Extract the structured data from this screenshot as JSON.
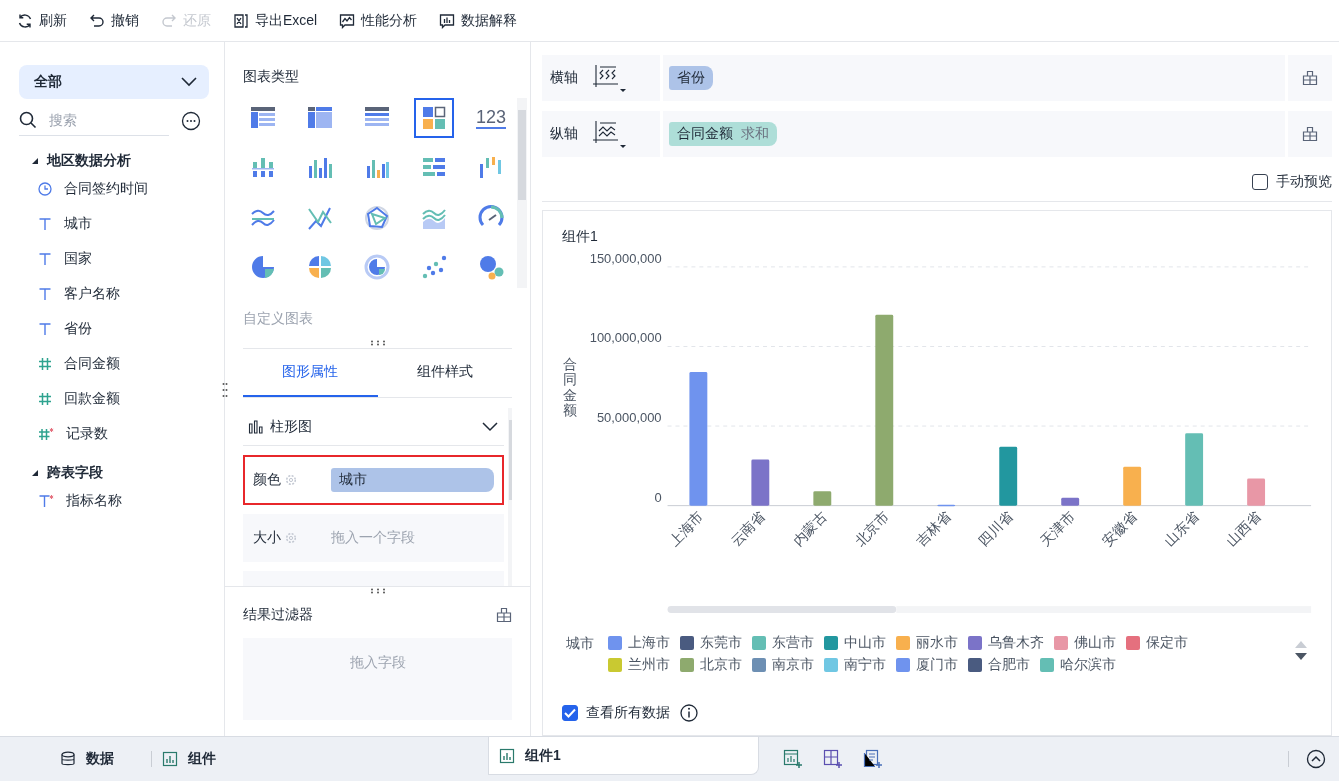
{
  "toolbar": [
    {
      "label": "刷新",
      "disabled": false
    },
    {
      "label": "撤销",
      "disabled": false
    },
    {
      "label": "还原",
      "disabled": true
    },
    {
      "label": "导出Excel",
      "disabled": false
    },
    {
      "label": "性能分析",
      "disabled": false
    },
    {
      "label": "数据解释",
      "disabled": false
    }
  ],
  "fields_panel": {
    "scope": "全部",
    "search": {
      "placeholder": "搜索"
    },
    "groups": [
      {
        "label": "地区数据分析",
        "expanded": true,
        "children": [
          {
            "label": "合同签约时间",
            "kind": "time"
          },
          {
            "label": "城市",
            "kind": "text"
          },
          {
            "label": "国家",
            "kind": "text"
          },
          {
            "label": "客户名称",
            "kind": "text"
          },
          {
            "label": "省份",
            "kind": "text"
          },
          {
            "label": "合同金额",
            "kind": "number"
          },
          {
            "label": "回款金额",
            "kind": "number"
          },
          {
            "label": "记录数",
            "kind": "calc-number"
          }
        ]
      },
      {
        "label": "跨表字段",
        "expanded": true,
        "children": [
          {
            "label": "指标名称",
            "kind": "calc-text"
          }
        ]
      }
    ]
  },
  "chart_types": {
    "title": "图表类型",
    "items": [
      {
        "kind": "table",
        "selected": false
      },
      {
        "kind": "group-table",
        "selected": false
      },
      {
        "kind": "cross-table",
        "selected": false
      },
      {
        "kind": "auto",
        "selected": true
      },
      {
        "kind": "number",
        "label": "123",
        "selected": false
      },
      {
        "kind": "grouped-bar",
        "selected": false
      },
      {
        "kind": "bar",
        "selected": false
      },
      {
        "kind": "multi-bar",
        "selected": false
      },
      {
        "kind": "hbar",
        "selected": false
      },
      {
        "kind": "range-bar",
        "selected": false
      },
      {
        "kind": "line",
        "selected": false
      },
      {
        "kind": "cross-line",
        "selected": false
      },
      {
        "kind": "radar",
        "selected": false
      },
      {
        "kind": "area",
        "selected": false
      },
      {
        "kind": "gauge",
        "selected": false
      },
      {
        "kind": "pie",
        "selected": false
      },
      {
        "kind": "multi-pie",
        "selected": false
      },
      {
        "kind": "ring",
        "selected": false
      },
      {
        "kind": "scatter",
        "selected": false
      },
      {
        "kind": "bubble",
        "selected": false
      }
    ],
    "custom_label": "自定义图表"
  },
  "prop_tabs": [
    {
      "label": "图形属性",
      "selected": true
    },
    {
      "label": "组件样式",
      "selected": false
    }
  ],
  "chart_kind": "柱形图",
  "props": [
    {
      "label": "颜色",
      "value": "城市",
      "highlighted": true
    },
    {
      "label": "大小",
      "placeholder": "拖入一个字段",
      "highlighted": false
    }
  ],
  "result_filter": {
    "title": "结果过滤器",
    "placeholder": "拖入字段"
  },
  "axes": [
    {
      "label": "横轴",
      "field": "省份",
      "kind": "dimension"
    },
    {
      "label": "纵轴",
      "field": "合同金额",
      "aggregation": "求和",
      "kind": "measure"
    }
  ],
  "manual_preview": {
    "label": "手动预览",
    "checked": false
  },
  "widget": {
    "title": "组件1",
    "chart_data": {
      "type": "bar",
      "ylabel": "合同金额",
      "categories": [
        "上海市",
        "云南省",
        "内蒙古",
        "北京市",
        "吉林省",
        "四川省",
        "天津市",
        "安徽省",
        "山东省",
        "山西省"
      ],
      "series": [
        {
          "color": "#6f93ee",
          "values": [
            84000000,
            null,
            null,
            null,
            600000,
            null,
            null,
            null,
            null,
            null
          ]
        },
        {
          "color": "#7b73c8",
          "values": [
            null,
            29000000,
            null,
            null,
            null,
            null,
            5000000,
            null,
            null,
            null
          ]
        },
        {
          "color": "#8eaa6e",
          "values": [
            null,
            null,
            9000000,
            120000000,
            null,
            null,
            null,
            null,
            null,
            null
          ]
        },
        {
          "color": "#22979f",
          "values": [
            null,
            null,
            null,
            null,
            null,
            37000000,
            null,
            null,
            null,
            null
          ]
        },
        {
          "color": "#f8b04e",
          "values": [
            null,
            null,
            null,
            null,
            null,
            null,
            null,
            24500000,
            null,
            null
          ]
        },
        {
          "color": "#64beb4",
          "values": [
            null,
            null,
            null,
            null,
            null,
            null,
            null,
            null,
            45500000,
            null
          ]
        },
        {
          "color": "#e897a6",
          "values": [
            null,
            null,
            null,
            null,
            null,
            null,
            null,
            null,
            null,
            17000000
          ]
        }
      ],
      "ylim": [
        0,
        150000000
      ],
      "yticks": [
        {
          "value": 0,
          "label": "0"
        },
        {
          "value": 50000000,
          "label": "50,000,000"
        },
        {
          "value": 100000000,
          "label": "100,000,000"
        },
        {
          "value": 150000000,
          "label": "150,000,000"
        }
      ]
    },
    "legend": {
      "title": "城市",
      "items": [
        {
          "label": "上海市",
          "color": "#6f93ee"
        },
        {
          "label": "东莞市",
          "color": "#4a5b80"
        },
        {
          "label": "东营市",
          "color": "#64beb4"
        },
        {
          "label": "中山市",
          "color": "#22979f"
        },
        {
          "label": "丽水市",
          "color": "#f8b04e"
        },
        {
          "label": "乌鲁木齐",
          "color": "#7b73c8"
        },
        {
          "label": "佛山市",
          "color": "#e897a6"
        },
        {
          "label": "保定市",
          "color": "#e5707e"
        },
        {
          "label": "兰州市",
          "color": "#c9c931"
        },
        {
          "label": "北京市",
          "color": "#8eaa6e"
        },
        {
          "label": "南京市",
          "color": "#6d8fb3"
        },
        {
          "label": "南宁市",
          "color": "#70c7e3"
        },
        {
          "label": "厦门市",
          "color": "#6f93ee"
        },
        {
          "label": "合肥市",
          "color": "#4a5b80"
        },
        {
          "label": "哈尔滨市",
          "color": "#64beb4"
        }
      ]
    },
    "view_all": {
      "label": "查看所有数据",
      "checked": true
    }
  },
  "bottom_tabs": [
    {
      "label": "数据",
      "selected": false
    },
    {
      "label": "组件",
      "selected": false
    },
    {
      "label": "组件1",
      "selected": true
    }
  ]
}
